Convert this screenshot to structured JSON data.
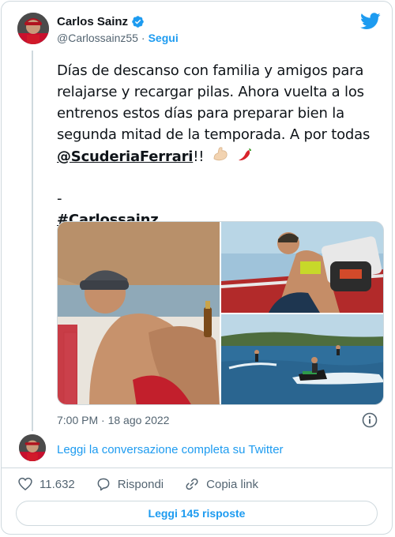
{
  "user": {
    "name": "Carlos Sainz",
    "handle": "@Carlossainz55",
    "separator": "·",
    "follow_label": "Segui"
  },
  "tweet": {
    "lines": [
      "Días de descanso con familia y amigos para",
      "relajarse y recargar pilas. Ahora vuelta a los",
      "entrenos estos días para preparar bien la",
      "segunda mitad de la temporada. A por todas"
    ],
    "mention": "@ScuderiaFerrari",
    "after_mention": "!!",
    "emojis": [
      "flexed-biceps-emoji",
      "hot-pepper-emoji"
    ],
    "dash": "-",
    "hashtag": "#Carlossainz"
  },
  "media": {
    "photos": [
      "man-on-boat-photo",
      "man-on-boat-deck-photo",
      "jet-ski-photo"
    ]
  },
  "meta": {
    "timestamp": "7:00 PM · 18 ago 2022"
  },
  "conversation": {
    "link_label": "Leggi la conversazione completa su Twitter"
  },
  "actions": {
    "likes_count": "11.632",
    "reply_label": "Rispondi",
    "copy_label": "Copia link"
  },
  "replies_button": {
    "label": "Leggi 145 risposte"
  },
  "colors": {
    "accent": "#1d9bf0",
    "text": "#0f1419",
    "muted": "#536471",
    "border": "#cfd9de"
  },
  "icons": {
    "brand": "twitter-bird-icon",
    "verified": "verified-badge-icon",
    "info": "info-icon",
    "like": "heart-icon",
    "reply": "speech-bubble-icon",
    "copy": "link-icon"
  }
}
